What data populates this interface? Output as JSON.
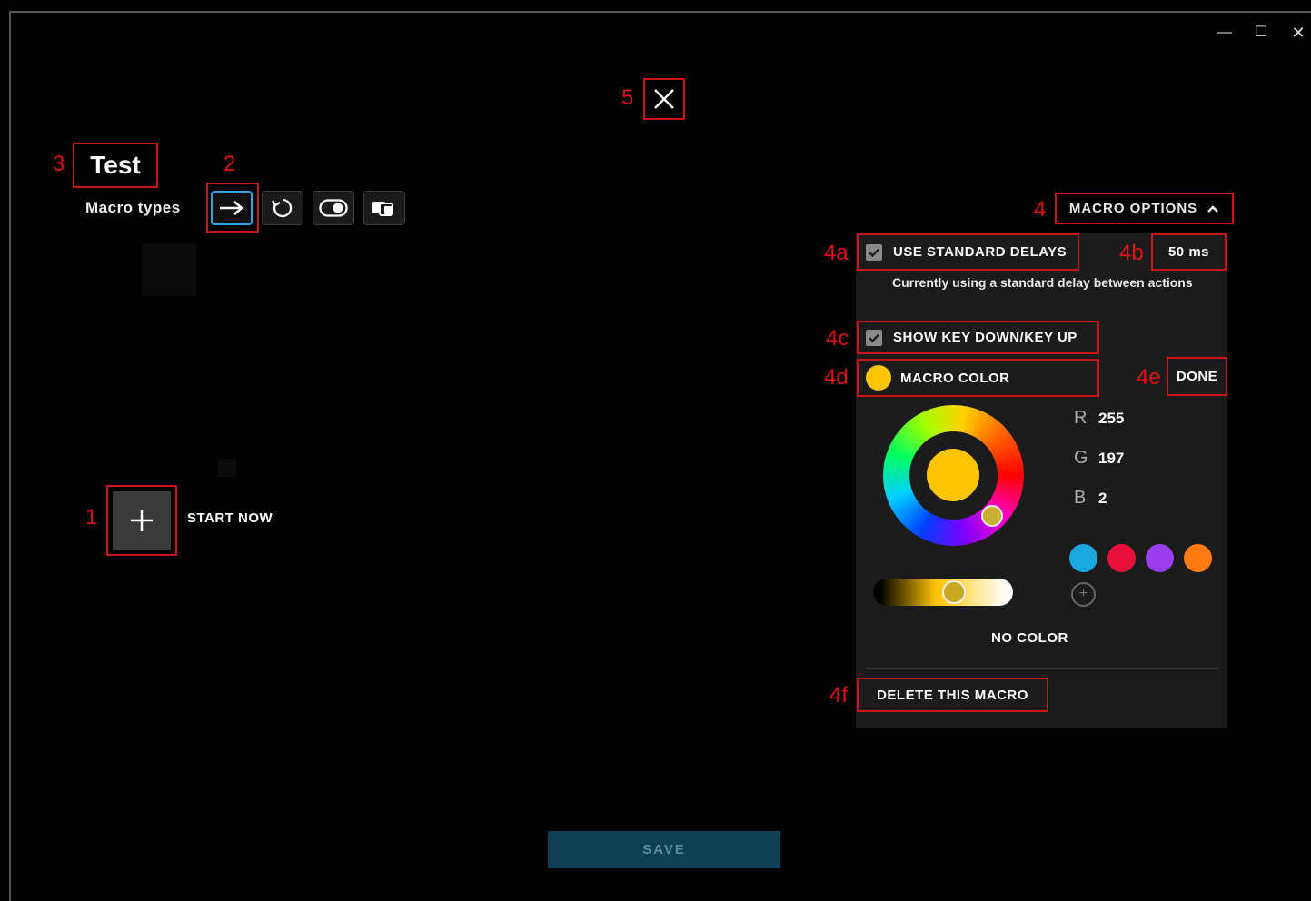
{
  "window": {
    "minimize_glyph": "—",
    "maximize_glyph": "☐",
    "close_glyph": "✕"
  },
  "annotations": {
    "a1": "1",
    "a2": "2",
    "a3": "3",
    "a4": "4",
    "a4a": "4a",
    "a4b": "4b",
    "a4c": "4c",
    "a4d": "4d",
    "a4e": "4e",
    "a4f": "4f",
    "a5": "5"
  },
  "editor": {
    "macro_name": "Test",
    "macro_types_label": "Macro types",
    "macro_types": [
      {
        "icon": "arrow-right-icon",
        "active": true
      },
      {
        "icon": "repeat-icon",
        "active": false
      },
      {
        "icon": "toggle-icon",
        "active": false
      },
      {
        "icon": "sequence-icon",
        "active": false
      }
    ],
    "start_label": "START NOW"
  },
  "options": {
    "header_label": "MACRO OPTIONS",
    "use_standard_delays_label": "USE STANDARD DELAYS",
    "use_standard_delays_checked": true,
    "delay_value": "50 ms",
    "delay_description": "Currently using a standard delay between actions",
    "show_keys_label": "SHOW KEY DOWN/KEY UP",
    "show_keys_checked": true,
    "macro_color_label": "MACRO COLOR",
    "done_label": "DONE",
    "color": {
      "current": "#ffc502",
      "r_label": "R",
      "r": "255",
      "g_label": "G",
      "g": "197",
      "b_label": "B",
      "b": "2"
    },
    "swatches": [
      "#1aa8e0",
      "#e8103a",
      "#9a3ef0",
      "#ff7a10"
    ],
    "no_color_label": "NO COLOR",
    "delete_label": "DELETE THIS MACRO"
  },
  "footer": {
    "save_label": "SAVE"
  }
}
